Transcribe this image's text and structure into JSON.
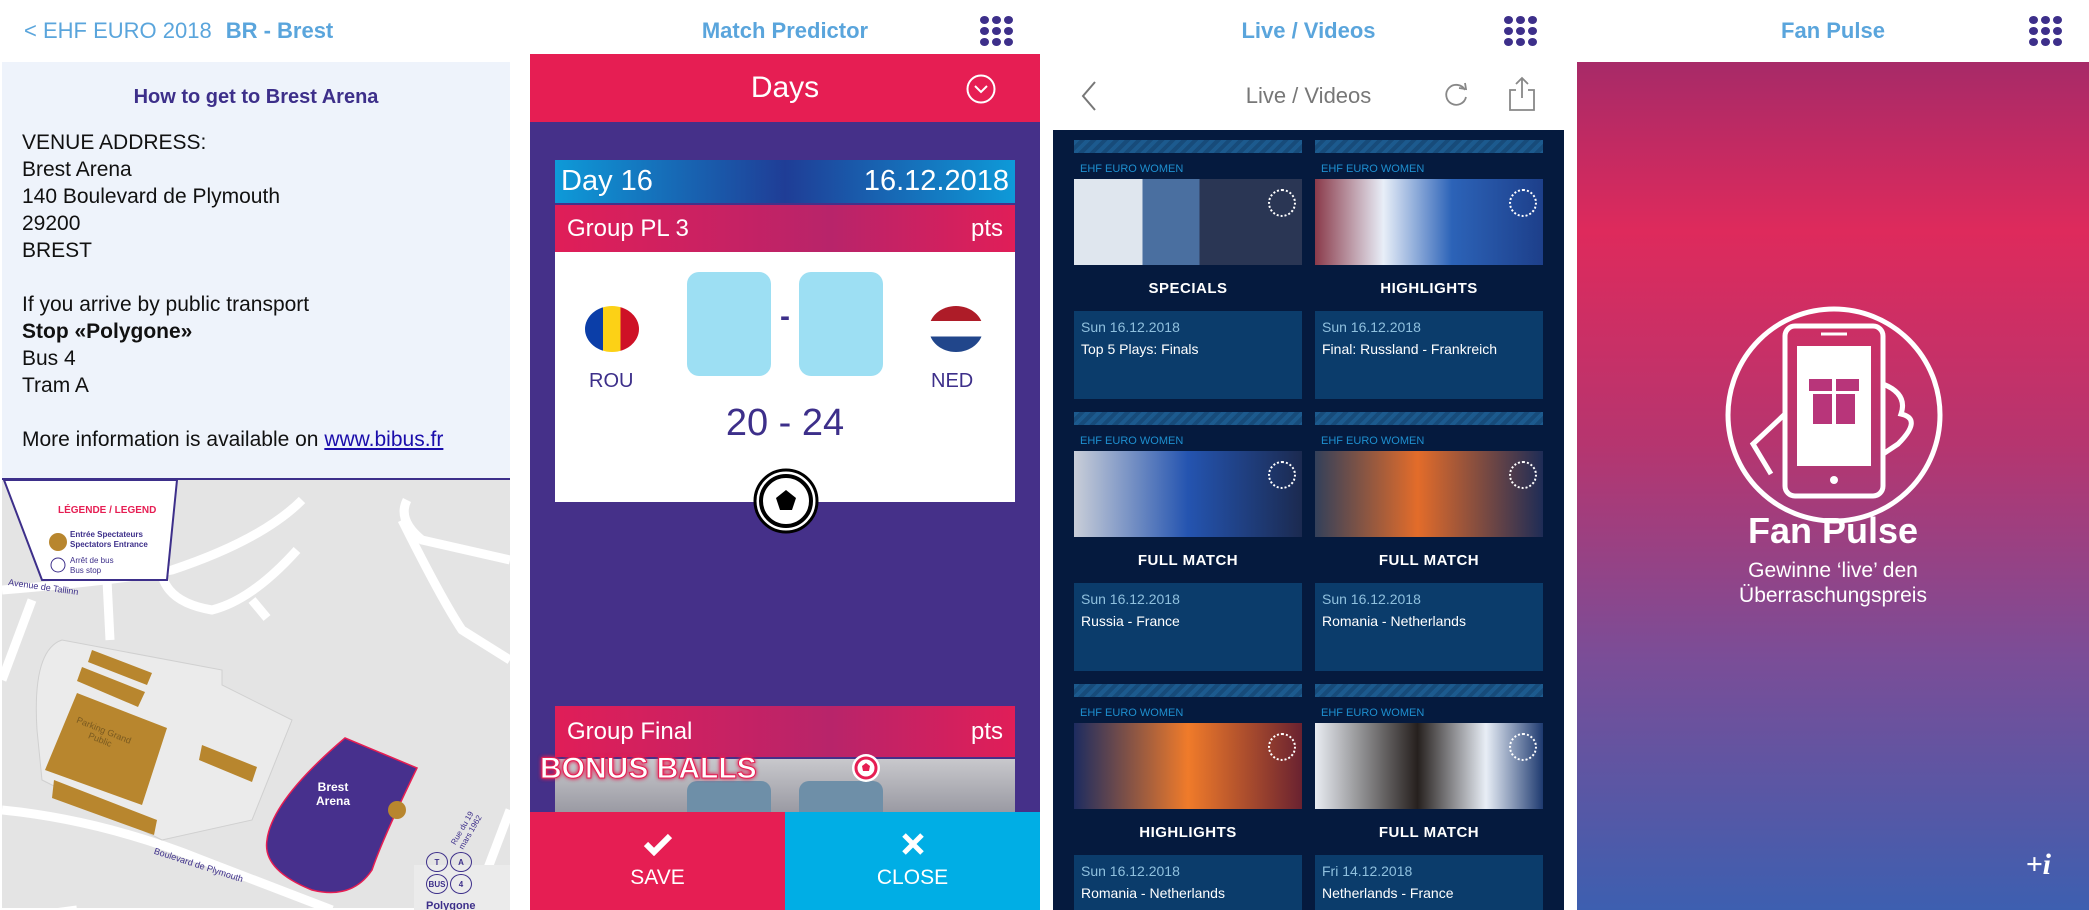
{
  "panel1": {
    "back_label": "< EHF EURO 2018",
    "title": "BR - Brest",
    "heading": "How to get to Brest Arena",
    "address_label": "VENUE ADDRESS:",
    "address": [
      "Brest Arena",
      "140 Boulevard de Plymouth",
      "29200",
      "BREST"
    ],
    "transport_intro": "If you arrive by public transport",
    "stop": "Stop «Polygone»",
    "lines": [
      "Bus 4",
      "Tram A"
    ],
    "more_info": "More information is available on ",
    "link": "www.bibus.fr",
    "map": {
      "legend_title": "LÉGENDE / LEGEND",
      "legend_entrance": [
        "Entrée Spectateurs",
        "Spectators Entrance"
      ],
      "legend_bus": [
        "Arrêt de bus",
        "Bus stop"
      ],
      "street1": "Avenue de Tallinn",
      "street2": "Boulevard de Plymouth",
      "street3": "Rue du 19 mars 1962",
      "parking": "Parking Grand Public",
      "arena": "Brest Arena",
      "stop_badges": [
        "T",
        "A",
        "BUS",
        "4"
      ],
      "stop_name": "Polygone"
    }
  },
  "panel2": {
    "title": "Match Predictor",
    "selector": "Days",
    "day": "Day 16",
    "date": "16.12.2018",
    "group": "Group PL 3",
    "pts": "pts",
    "home": "ROU",
    "away": "NED",
    "dash": "-",
    "result": "20 - 24",
    "group2": "Group Final",
    "bonus": "BONUS BALLS",
    "save": "SAVE",
    "close": "CLOSE",
    "colors": {
      "pink": "#e61e53",
      "purple": "#453089",
      "blue": "#00aee5"
    }
  },
  "panel3": {
    "title": "Live / Videos",
    "nav_title": "Live / Videos",
    "videos": [
      {
        "label": "EHF EURO WOMEN",
        "category": "SPECIALS",
        "date": "Sun 16.12.2018",
        "name": "Top 5 Plays: Finals"
      },
      {
        "label": "EHF EURO WOMEN",
        "category": "HIGHLIGHTS",
        "date": "Sun 16.12.2018",
        "name": "Final: Russland - Frankreich"
      },
      {
        "label": "EHF EURO WOMEN",
        "category": "FULL MATCH",
        "date": "Sun 16.12.2018",
        "name": "Russia - France"
      },
      {
        "label": "EHF EURO WOMEN",
        "category": "FULL MATCH",
        "date": "Sun 16.12.2018",
        "name": "Romania - Netherlands"
      },
      {
        "label": "EHF EURO WOMEN",
        "category": "HIGHLIGHTS",
        "date": "Sun 16.12.2018",
        "name": "Romania - Netherlands"
      },
      {
        "label": "EHF EURO WOMEN",
        "category": "FULL MATCH",
        "date": "Fri 14.12.2018",
        "name": "Netherlands - France"
      }
    ]
  },
  "panel4": {
    "title": "Fan Pulse",
    "heading": "Fan Pulse",
    "subtitle1": "Gewinne ‘live’ den",
    "subtitle2": "Überraschungspreis",
    "info_button": "+i"
  }
}
